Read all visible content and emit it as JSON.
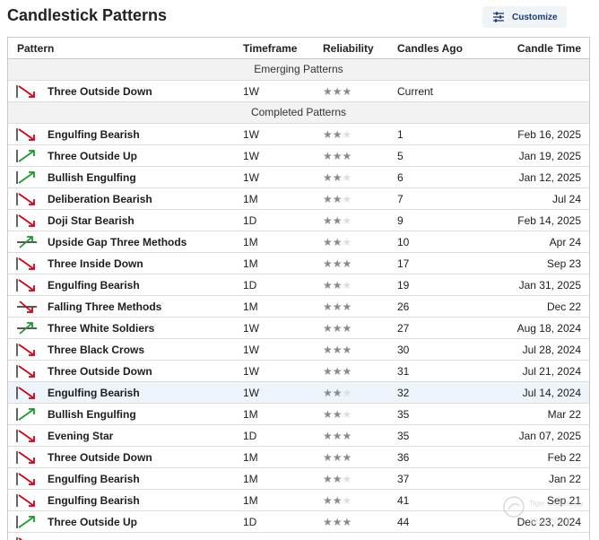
{
  "page": {
    "title": "Candlestick Patterns",
    "customize_label": "Customize"
  },
  "columns": {
    "pattern": "Pattern",
    "timeframe": "Timeframe",
    "reliability": "Reliability",
    "candles_ago": "Candles Ago",
    "candle_time": "Candle Time"
  },
  "sections": {
    "emerging": "Emerging Patterns",
    "completed": "Completed Patterns"
  },
  "colors": {
    "bearish": "#d0021b",
    "bullish": "#1a9a2a",
    "star_on": "#8a8a8a",
    "star_off": "#dedede"
  },
  "emerging": [
    {
      "name": "Three Outside Down",
      "trend": "bearish",
      "timeframe": "1W",
      "stars": 3,
      "ago": "Current",
      "time": ""
    }
  ],
  "completed": [
    {
      "name": "Engulfing Bearish",
      "trend": "bearish",
      "timeframe": "1W",
      "stars": 2,
      "ago": "1",
      "time": "Feb 16, 2025"
    },
    {
      "name": "Three Outside Up",
      "trend": "bullish",
      "timeframe": "1W",
      "stars": 3,
      "ago": "5",
      "time": "Jan 19, 2025"
    },
    {
      "name": "Bullish Engulfing",
      "trend": "bullish",
      "timeframe": "1W",
      "stars": 2,
      "ago": "6",
      "time": "Jan 12, 2025"
    },
    {
      "name": "Deliberation Bearish",
      "trend": "bearish",
      "timeframe": "1M",
      "stars": 2,
      "ago": "7",
      "time": "Jul 24"
    },
    {
      "name": "Doji Star Bearish",
      "trend": "bearish",
      "timeframe": "1D",
      "stars": 2,
      "ago": "9",
      "time": "Feb 14, 2025"
    },
    {
      "name": "Upside Gap Three Methods",
      "trend": "bullish-cont",
      "timeframe": "1M",
      "stars": 2,
      "ago": "10",
      "time": "Apr 24"
    },
    {
      "name": "Three Inside Down",
      "trend": "bearish",
      "timeframe": "1M",
      "stars": 3,
      "ago": "17",
      "time": "Sep 23"
    },
    {
      "name": "Engulfing Bearish",
      "trend": "bearish",
      "timeframe": "1D",
      "stars": 2,
      "ago": "19",
      "time": "Jan 31, 2025"
    },
    {
      "name": "Falling Three Methods",
      "trend": "bearish-cont",
      "timeframe": "1M",
      "stars": 3,
      "ago": "26",
      "time": "Dec 22"
    },
    {
      "name": "Three White Soldiers",
      "trend": "bullish-cont",
      "timeframe": "1W",
      "stars": 3,
      "ago": "27",
      "time": "Aug 18, 2024"
    },
    {
      "name": "Three Black Crows",
      "trend": "bearish",
      "timeframe": "1W",
      "stars": 3,
      "ago": "30",
      "time": "Jul 28, 2024"
    },
    {
      "name": "Three Outside Down",
      "trend": "bearish",
      "timeframe": "1W",
      "stars": 3,
      "ago": "31",
      "time": "Jul 21, 2024"
    },
    {
      "name": "Engulfing Bearish",
      "trend": "bearish",
      "timeframe": "1W",
      "stars": 2,
      "ago": "32",
      "time": "Jul 14, 2024",
      "highlight": true
    },
    {
      "name": "Bullish Engulfing",
      "trend": "bullish",
      "timeframe": "1M",
      "stars": 2,
      "ago": "35",
      "time": "Mar 22"
    },
    {
      "name": "Evening Star",
      "trend": "bearish",
      "timeframe": "1D",
      "stars": 3,
      "ago": "35",
      "time": "Jan 07, 2025"
    },
    {
      "name": "Three Outside Down",
      "trend": "bearish",
      "timeframe": "1M",
      "stars": 3,
      "ago": "36",
      "time": "Feb 22"
    },
    {
      "name": "Engulfing Bearish",
      "trend": "bearish",
      "timeframe": "1M",
      "stars": 2,
      "ago": "37",
      "time": "Jan 22"
    },
    {
      "name": "Engulfing Bearish",
      "trend": "bearish",
      "timeframe": "1M",
      "stars": 2,
      "ago": "41",
      "time": "Sep 21"
    },
    {
      "name": "Three Outside Up",
      "trend": "bullish",
      "timeframe": "1D",
      "stars": 3,
      "ago": "44",
      "time": "Dec 23, 2024"
    },
    {
      "name": "",
      "trend": "bearish",
      "timeframe": "",
      "stars": 0,
      "ago": "",
      "time": ""
    }
  ],
  "watermark": {
    "line1": "Tiger Community",
    "line2": "@aK2040"
  }
}
